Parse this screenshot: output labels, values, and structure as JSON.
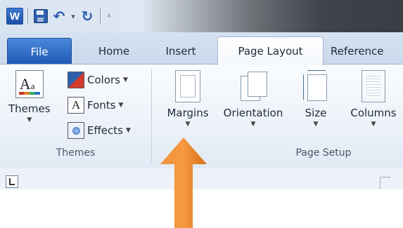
{
  "qat": {
    "app_icon": "W",
    "icons": [
      "word-icon",
      "save-icon",
      "undo-icon",
      "undo-dropdown-icon",
      "redo-icon",
      "customize-qat-icon"
    ]
  },
  "tabs": [
    {
      "label": "File"
    },
    {
      "label": "Home"
    },
    {
      "label": "Insert"
    },
    {
      "label": "Page Layout",
      "active": true
    },
    {
      "label": "Reference"
    }
  ],
  "groups": {
    "themes": {
      "label": "Themes",
      "themes_button": "Themes",
      "colors": "Colors",
      "fonts": "Fonts",
      "effects": "Effects"
    },
    "page_setup": {
      "label": "Page Setup",
      "margins": "Margins",
      "orientation": "Orientation",
      "size": "Size",
      "columns": "Columns"
    }
  },
  "annotation": {
    "arrow_color": "#e87722",
    "points_to": "Margins"
  },
  "colors": {
    "file_tab": "#2b65c1",
    "arrow": "#e87722"
  }
}
